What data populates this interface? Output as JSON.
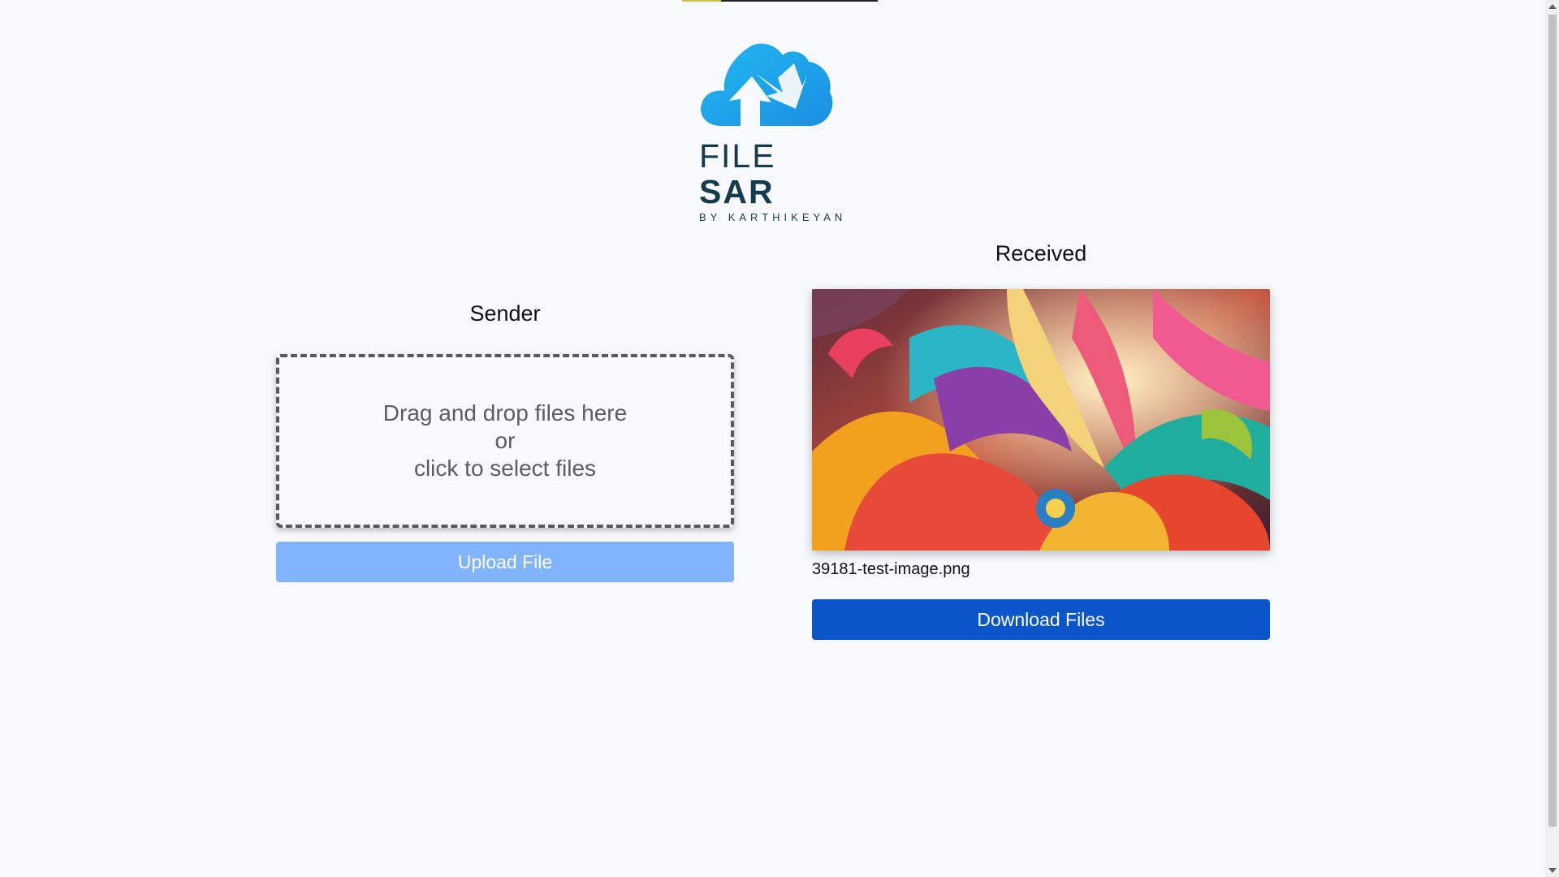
{
  "brand": {
    "name_light": "FILE ",
    "name_bold": "SAR",
    "byline": "BY KARTHIKEYAN",
    "colors": {
      "cloud_top": "#2ab4ef",
      "cloud_bottom": "#1a8fe3",
      "text": "#163b4d"
    }
  },
  "sender": {
    "title": "Sender",
    "dropzone": {
      "line1": "Drag and drop files here",
      "line2": "or",
      "line3": "click to select files"
    },
    "upload_label": "Upload File"
  },
  "received": {
    "title": "Received",
    "preview_icon": "abstract-image",
    "filename": "39181-test-image.png",
    "download_label": "Download Files"
  },
  "colors": {
    "background": "#f8f9fc",
    "upload_button": "#82b4fe",
    "download_button": "#0b55cb"
  }
}
